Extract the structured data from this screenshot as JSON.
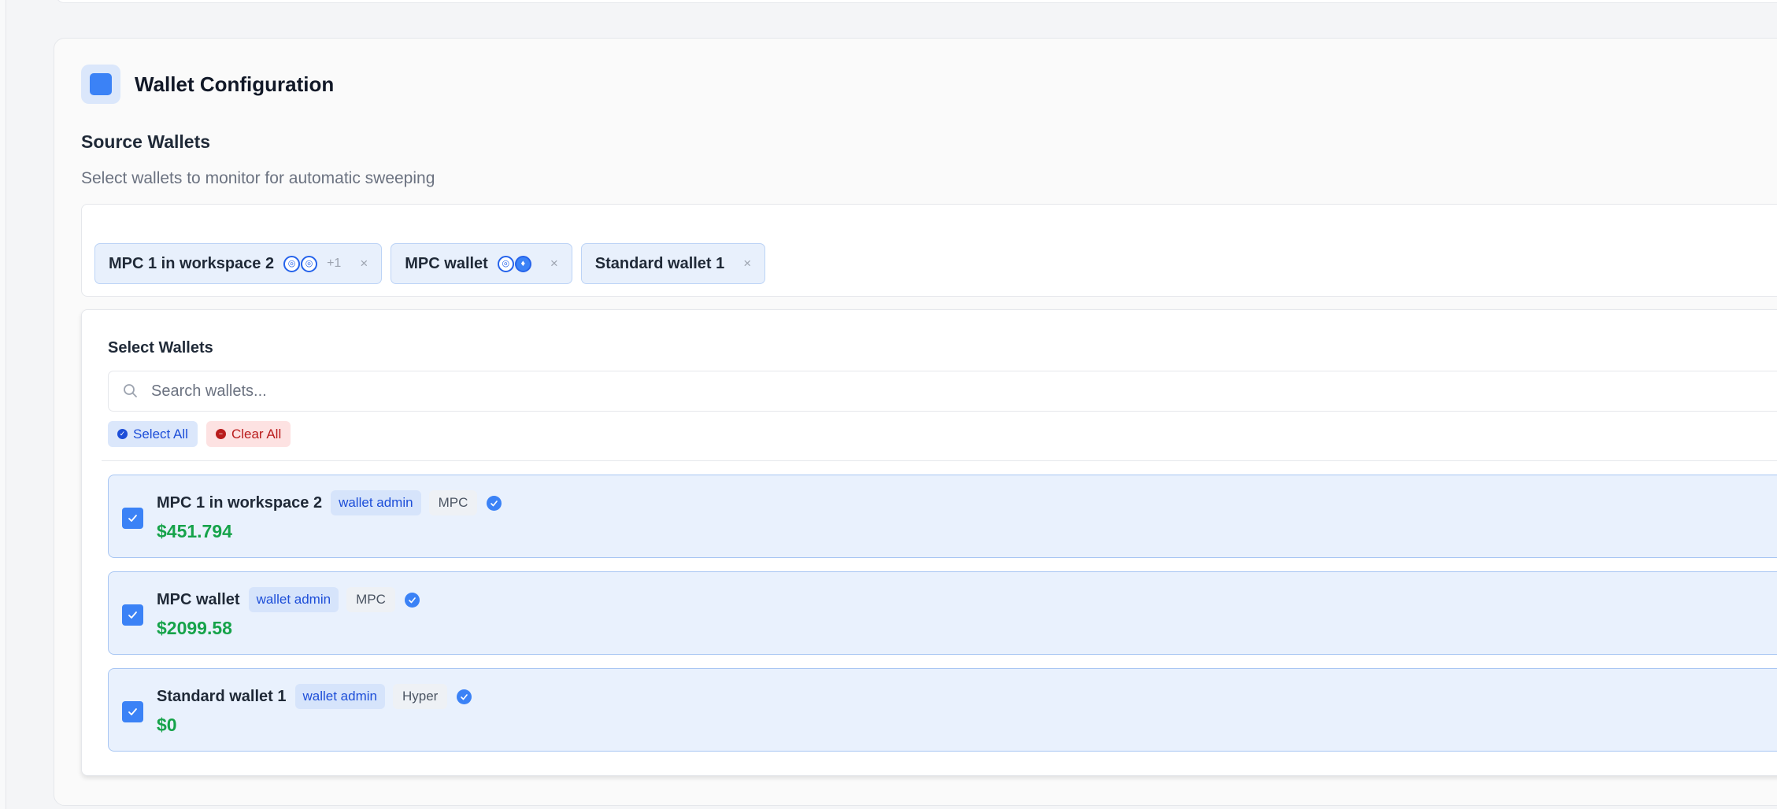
{
  "colors": {
    "accent": "#3b82f6",
    "balance_green": "#16a34a",
    "danger": "#b91c1c"
  },
  "header": {
    "title": "Wallet Configuration",
    "icon": "square-icon"
  },
  "section": {
    "title": "Source Wallets",
    "subtitle": "Select wallets to monitor for automatic sweeping"
  },
  "chips": [
    {
      "label": "MPC 1 in workspace 2",
      "icons": [
        "token-icon",
        "token-icon"
      ],
      "more": "+1",
      "remove": "×"
    },
    {
      "label": "MPC wallet",
      "icons": [
        "token-icon",
        "ethereum-icon"
      ],
      "remove": "×"
    },
    {
      "label": "Standard wallet 1",
      "remove": "×"
    }
  ],
  "dropdown": {
    "title": "Select Wallets",
    "search_placeholder": "Search wallets...",
    "select_all_label": "Select All",
    "clear_all_label": "Clear All"
  },
  "wallets": [
    {
      "name": "MPC 1 in workspace 2",
      "role": "wallet admin",
      "type": "MPC",
      "balance": "$451.794",
      "checked": true,
      "verified": true
    },
    {
      "name": "MPC wallet",
      "role": "wallet admin",
      "type": "MPC",
      "balance": "$2099.58",
      "checked": true,
      "verified": true
    },
    {
      "name": "Standard wallet 1",
      "role": "wallet admin",
      "type": "Hyper",
      "balance": "$0",
      "checked": true,
      "verified": true
    }
  ]
}
